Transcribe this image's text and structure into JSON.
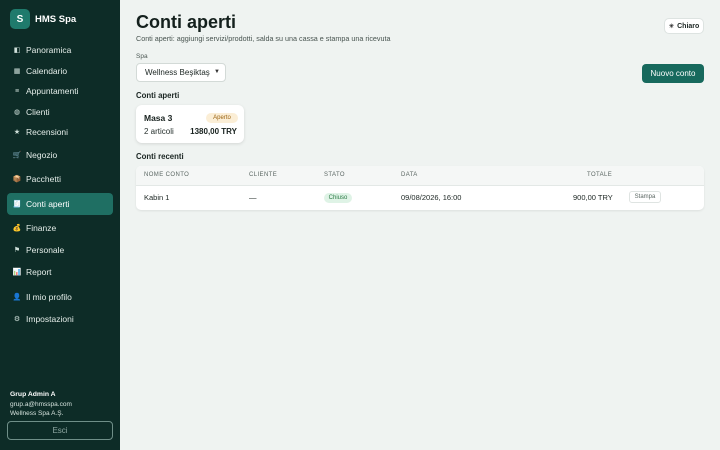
{
  "brand": {
    "logo_letter": "S",
    "name": "HMS Spa"
  },
  "sidebar": {
    "items": [
      {
        "label": "Panoramica",
        "icon": "◧"
      },
      {
        "label": "Calendario",
        "icon": "▦"
      },
      {
        "label": "Appuntamenti",
        "icon": "≡"
      },
      {
        "label": "Clienti",
        "icon": "◍"
      },
      {
        "label": "Recensioni",
        "icon": "★"
      },
      {
        "label": "Negozio",
        "icon": "🛒"
      },
      {
        "label": "Pacchetti",
        "icon": "📦"
      },
      {
        "label": "Conti aperti",
        "icon": "🧾"
      },
      {
        "label": "Finanze",
        "icon": "💰"
      },
      {
        "label": "Personale",
        "icon": "⚑"
      },
      {
        "label": "Report",
        "icon": "📊"
      },
      {
        "label": "Il mio profilo",
        "icon": "👤"
      },
      {
        "label": "Impostazioni",
        "icon": "⚙"
      }
    ],
    "active": "Conti aperti",
    "user": {
      "name": "Grup Admin A",
      "email": "grup.a@hmsspa.com",
      "company": "Wellness Spa A.Ş."
    },
    "logout_label": "Esci"
  },
  "header": {
    "title": "Conti aperti",
    "subtitle": "Conti aperti: aggiungi servizi/prodotti, salda su una cassa e stampa una ricevuta",
    "theme_label": "Chiaro"
  },
  "filters": {
    "spa_label": "Spa",
    "spa_value": "Wellness Beşiktaş"
  },
  "actions": {
    "new_tab_label": "Nuovo conto"
  },
  "open_tabs": {
    "section_title": "Conti aperti",
    "items": [
      {
        "name": "Masa 3",
        "status": "Aperto",
        "items_text": "2 articoli",
        "total": "1380,00 TRY"
      }
    ]
  },
  "recent_tabs": {
    "section_title": "Conti recenti",
    "columns": [
      "NOME CONTO",
      "CLIENTE",
      "STATO",
      "DATA",
      "TOTALE"
    ],
    "rows": [
      {
        "name": "Kabin 1",
        "customer": "—",
        "status": "Chiuso",
        "date": "09/08/2026, 16:00",
        "total": "900,00 TRY",
        "action": "Stampa"
      }
    ]
  },
  "colors": {
    "sidebar_bg": "#0d2c27",
    "accent": "#17695d",
    "open_badge": "#fbeed6",
    "closed_badge": "#dff3e6"
  }
}
